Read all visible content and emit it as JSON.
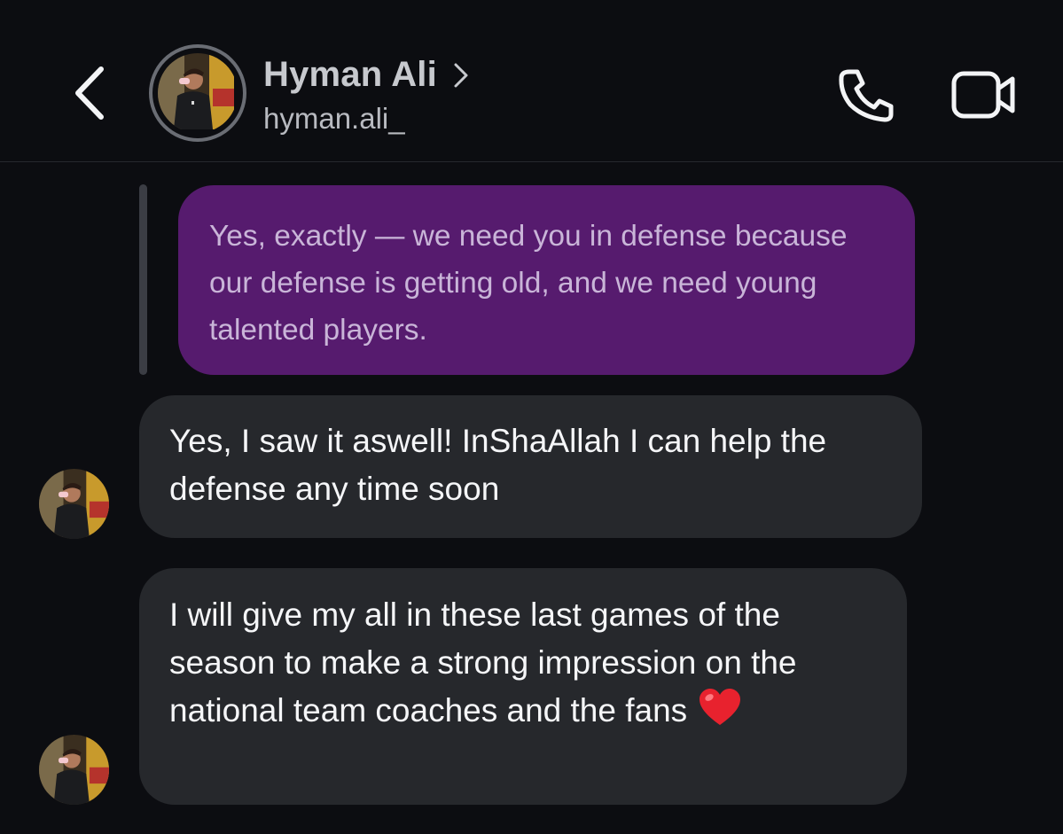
{
  "header": {
    "name": "Hyman Ali",
    "username": "hyman.ali_",
    "icons": {
      "back": "chevron-left-icon",
      "profile_link": "chevron-right-icon",
      "call": "phone-icon",
      "video": "video-camera-icon"
    }
  },
  "colors": {
    "background": "#0c0d11",
    "quoted_bubble": "#561b6e",
    "received_bubble": "#26282c"
  },
  "messages": [
    {
      "type": "quoted_reply",
      "text": "Yes, exactly — we need you in defense because our defense is getting old, and we need young talented players."
    },
    {
      "type": "received",
      "text": "Yes, I saw it aswell! InShaAllah I can help the defense any time soon"
    },
    {
      "type": "received",
      "text": "I will give my all in these last games of the season to make a strong impression on the national team coaches and the fans",
      "emoji": "❤️"
    }
  ]
}
